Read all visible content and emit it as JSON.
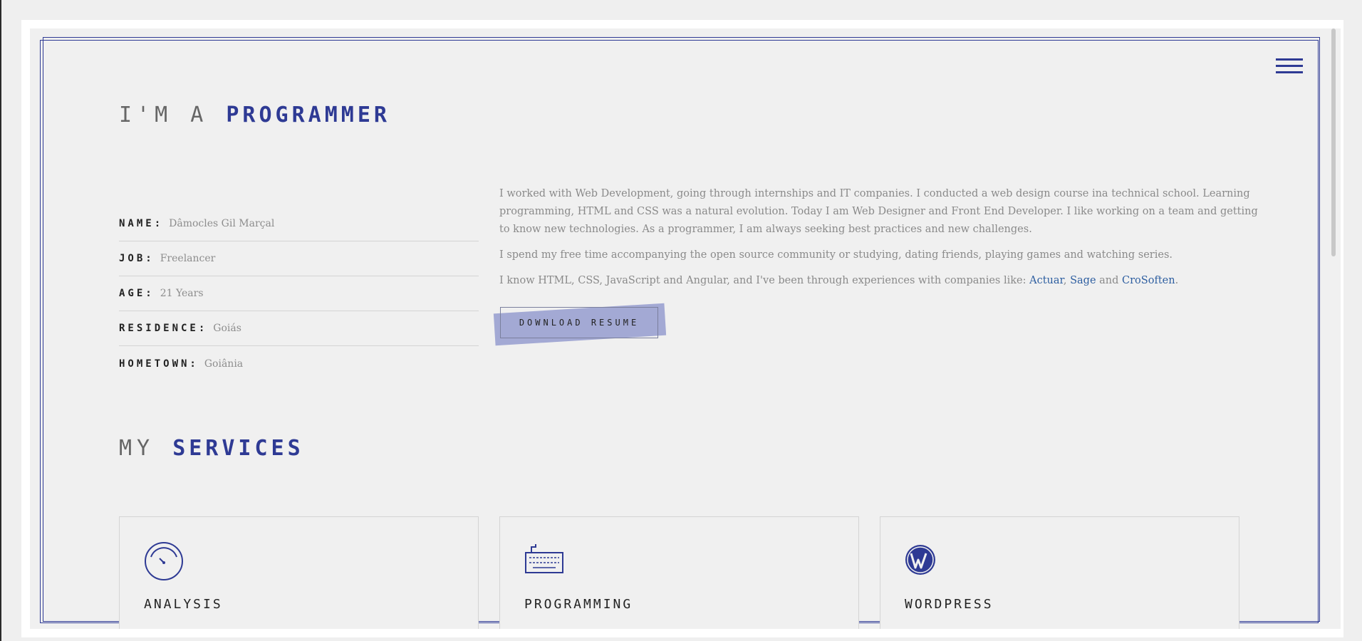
{
  "about": {
    "title_light": "I'M A",
    "title_strong": "PROGRAMMER",
    "info": [
      {
        "key": "NAME:",
        "value": "Dâmocles Gil Marçal"
      },
      {
        "key": "JOB:",
        "value": "Freelancer"
      },
      {
        "key": "AGE:",
        "value": "21 Years"
      },
      {
        "key": "RESIDENCE:",
        "value": "Goiás"
      },
      {
        "key": "HOMETOWN:",
        "value": "Goiânia"
      }
    ],
    "bio_p1": "I worked with Web Development, going through internships and IT companies. I conducted a web design course ina technical school. Learning programming, HTML and CSS was a natural evolution. Today I am Web Designer and Front End Developer. I like working on a team and getting to know new technologies. As a programmer, I am always seeking best practices and new challenges.",
    "bio_p2": "I spend my free time accompanying the open source community or studying, dating friends, playing games and watching series.",
    "bio_p3_prefix": "I know HTML, CSS, JavaScript and Angular, and I've been through experiences with companies like: ",
    "companies": [
      "Actuar",
      "Sage",
      "CroSoften"
    ],
    "sep1": ", ",
    "sep2": " and ",
    "end": ".",
    "resume_label": "DOWNLOAD RESUME"
  },
  "services": {
    "title_light": "MY",
    "title_strong": "SERVICES",
    "items": [
      {
        "name": "ANALYSIS",
        "icon": "speedometer-icon"
      },
      {
        "name": "PROGRAMMING",
        "icon": "keyboard-icon"
      },
      {
        "name": "WORDPRESS",
        "icon": "wordpress-icon"
      }
    ]
  },
  "colors": {
    "accent": "#2e3a94",
    "resume_highlight": "#a3a9d4",
    "link": "#2d5ea0"
  }
}
